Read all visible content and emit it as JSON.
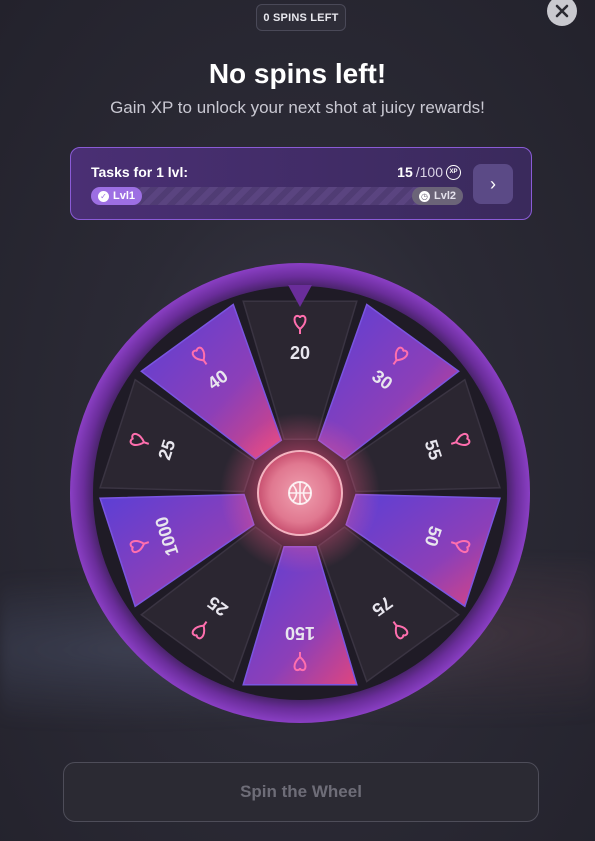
{
  "header": {
    "spins_left": "0 SPINS LEFT",
    "title": "No spins left!",
    "subtitle": "Gain XP to unlock your next shot at juicy rewards!"
  },
  "tasks": {
    "label": "Tasks for 1 lvl:",
    "xp_current": "15",
    "xp_total": "/100",
    "xp_icon": "XP",
    "progress_fraction": 0.15,
    "level_from": "Lvl1",
    "level_to": "Lvl2"
  },
  "wheel": {
    "segments": [
      "20",
      "30",
      "55",
      "50",
      "75",
      "150",
      "25",
      "1000",
      "25",
      "40"
    ],
    "segment_styles": [
      "dark",
      "purple",
      "dark",
      "purple",
      "dark",
      "purple",
      "dark",
      "purple",
      "dark",
      "purple"
    ],
    "colors": {
      "rim": "#6a2d9a",
      "purple": "#6a3bd8",
      "pink": "#e8457e",
      "dark": "#2c2733",
      "center": "#e07890"
    }
  },
  "spin_button": {
    "label": "Spin the Wheel"
  }
}
